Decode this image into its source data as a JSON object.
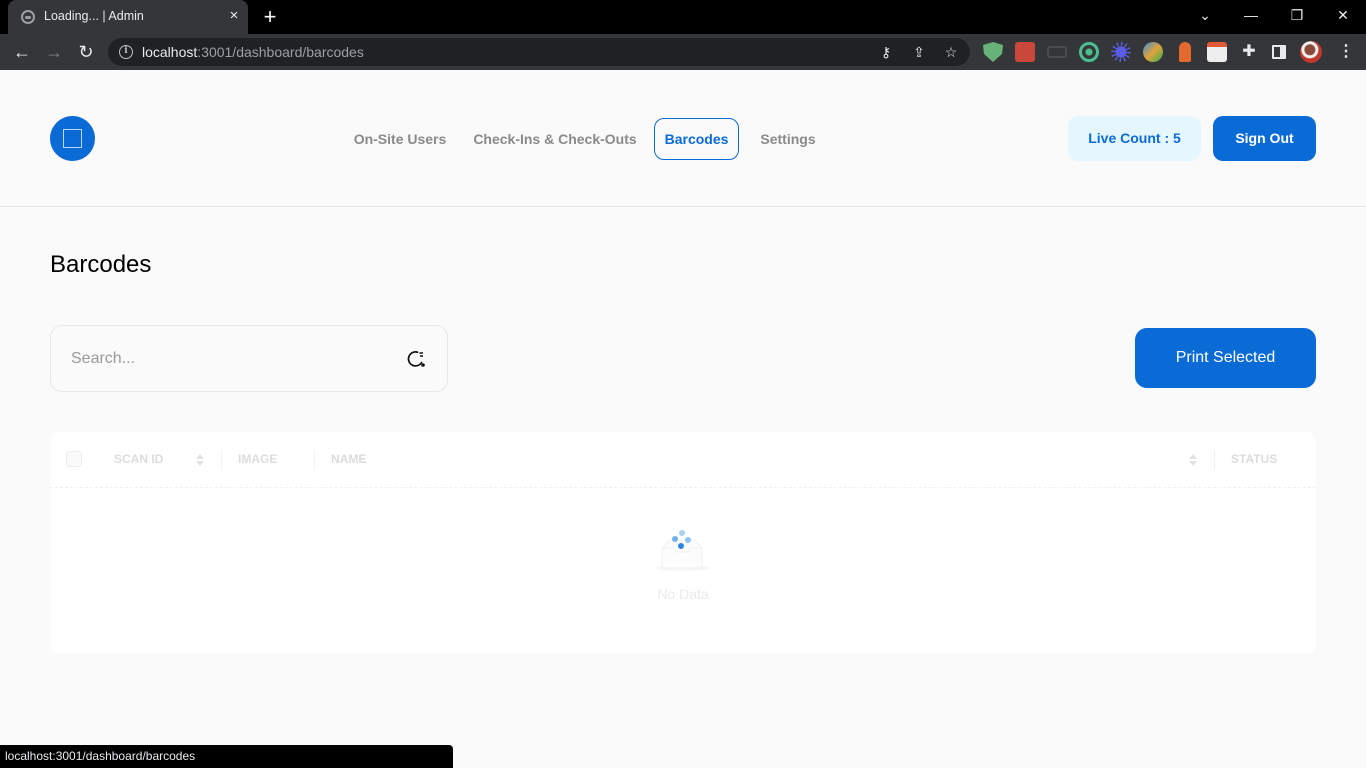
{
  "browser": {
    "tab_title": "Loading... | Admin",
    "url_host": "localhost",
    "url_rest": ":3001/dashboard/barcodes",
    "status_url": "localhost:3001/dashboard/barcodes",
    "icons": {
      "tab_close": "×",
      "new_tab": "+",
      "tab_search": "⌄",
      "minimize": "—",
      "restore": "❐",
      "close": "✕",
      "back": "←",
      "forward": "→",
      "reload": "↻",
      "info": "i",
      "key": "⚷",
      "share": "⇪",
      "star": "☆",
      "puzzle": "✚",
      "menu": "⋮"
    }
  },
  "header": {
    "nav": [
      {
        "label": "On-Site Users",
        "active": false
      },
      {
        "label": "Check-Ins & Check-Outs",
        "active": false
      },
      {
        "label": "Barcodes",
        "active": true
      },
      {
        "label": "Settings",
        "active": false
      }
    ],
    "live_count_label": "Live Count : 5",
    "sign_out_label": "Sign Out"
  },
  "main": {
    "title": "Barcodes",
    "search": {
      "placeholder": "Search...",
      "value": ""
    },
    "print_selected_label": "Print Selected",
    "table": {
      "columns": [
        "SCAN ID",
        "IMAGE",
        "NAME",
        "STATUS"
      ],
      "rows": [],
      "empty_text": "No Data"
    }
  },
  "colors": {
    "primary": "#0b6bd6",
    "live_count_bg": "#e6f6ff",
    "page_bg": "#fafafa"
  }
}
